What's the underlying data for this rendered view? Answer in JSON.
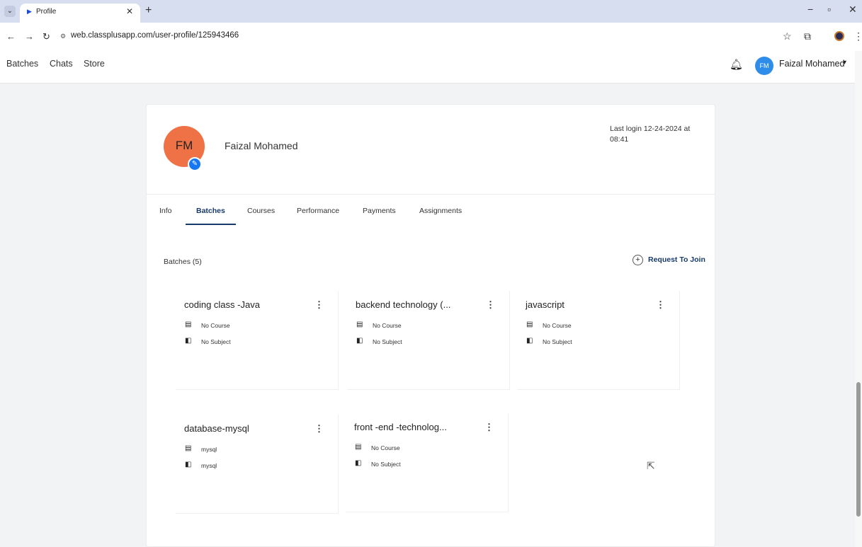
{
  "browser": {
    "tab_title": "Profile",
    "tab_menu_icon": "chevron-down-icon",
    "favicon_icon": "play-icon",
    "url": "web.classplusapp.com/user-profile/125943466"
  },
  "app_nav": {
    "links": [
      "Batches",
      "Chats",
      "Store"
    ],
    "user_initials": "FM",
    "user_name": "Faizal Mohamed"
  },
  "profile": {
    "initials": "FM",
    "name": "Faizal Mohamed",
    "last_login": "Last login 12-24-2024 at 08:41"
  },
  "tabs": [
    {
      "label": "Info",
      "active": false
    },
    {
      "label": "Batches",
      "active": true
    },
    {
      "label": "Courses",
      "active": false
    },
    {
      "label": "Performance",
      "active": false
    },
    {
      "label": "Payments",
      "active": false
    },
    {
      "label": "Assignments",
      "active": false
    }
  ],
  "batches": {
    "count_label": "Batches (5)",
    "request_label": "Request To Join",
    "items": [
      {
        "title": "coding class -Java",
        "course": "No Course",
        "subject": "No Subject"
      },
      {
        "title": "backend technology (...",
        "course": "No Course",
        "subject": "No Subject"
      },
      {
        "title": "javascript",
        "course": "No Course",
        "subject": "No Subject"
      },
      {
        "title": "database-mysql",
        "course": "mysql",
        "subject": "mysql"
      },
      {
        "title": "front -end -technolog...",
        "course": "No Course",
        "subject": "No Subject"
      }
    ]
  },
  "colors": {
    "accent": "#173a6a",
    "avatar_orange": "#ee7246",
    "user_avatar_blue": "#2d8de8",
    "edit_badge_blue": "#1677f2"
  }
}
